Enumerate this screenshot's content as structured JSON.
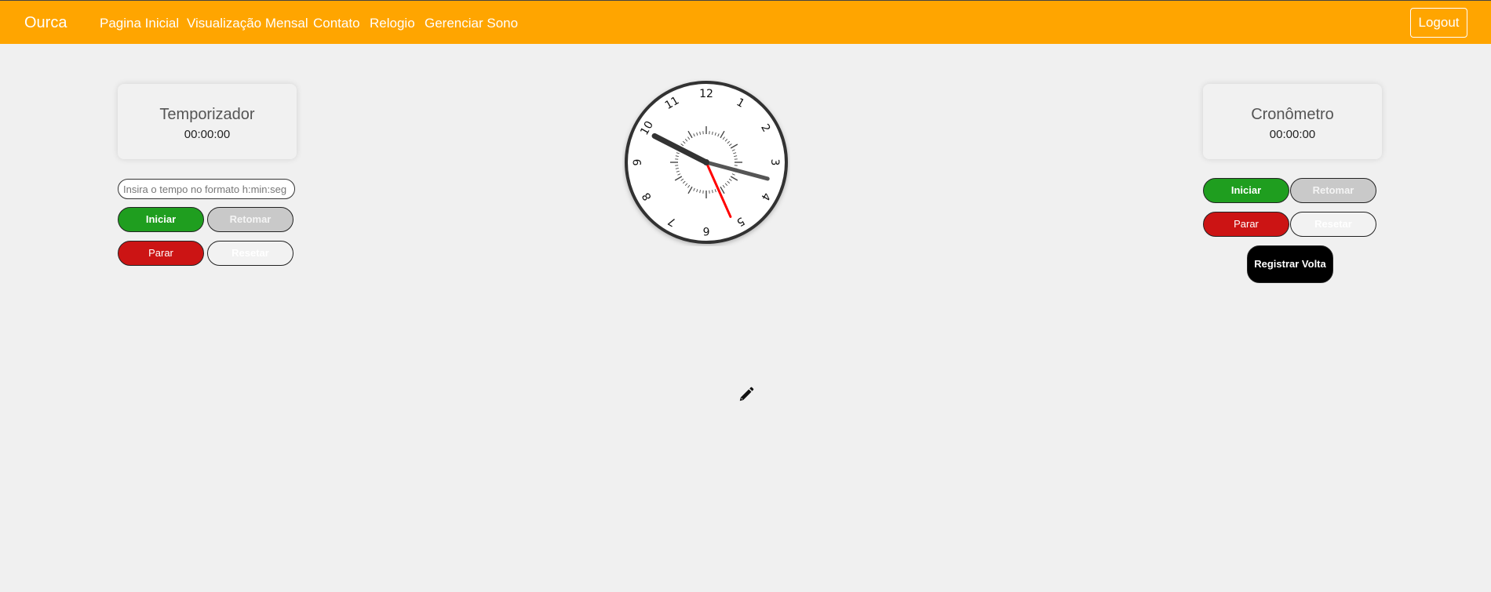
{
  "navbar": {
    "brand": "Ourca",
    "links": [
      "Pagina Inicial",
      "Visualização Mensal",
      "Contato",
      "Relogio",
      "Gerenciar Sono"
    ],
    "logout": "Logout",
    "bg_color": "#ffa500"
  },
  "timer": {
    "title": "Temporizador",
    "time": "00:00:00",
    "input_placeholder": "Insira o tempo no formato h:min:seg",
    "buttons": {
      "start": "Iniciar",
      "resume": "Retomar",
      "stop": "Parar",
      "reset": "Resetar"
    }
  },
  "clock": {
    "numbers": [
      "12",
      "1",
      "2",
      "3",
      "4",
      "5",
      "6",
      "7",
      "8",
      "9",
      "10",
      "11"
    ],
    "time_shown": {
      "hour": 9.9,
      "minute": 17.5,
      "second": 26
    }
  },
  "stopwatch": {
    "title": "Cronômetro",
    "time": "00:00:00",
    "buttons": {
      "start": "Iniciar",
      "resume": "Retomar",
      "stop": "Parar",
      "reset": "Resetar",
      "lap": "Registrar Volta"
    }
  },
  "icons": {
    "edit": "pencil-icon"
  },
  "colors": {
    "start": "#1f9e1f",
    "stop": "#cc1414",
    "disabled": "#c9c9c9",
    "lap": "#000000",
    "second_hand": "#ff0000"
  }
}
